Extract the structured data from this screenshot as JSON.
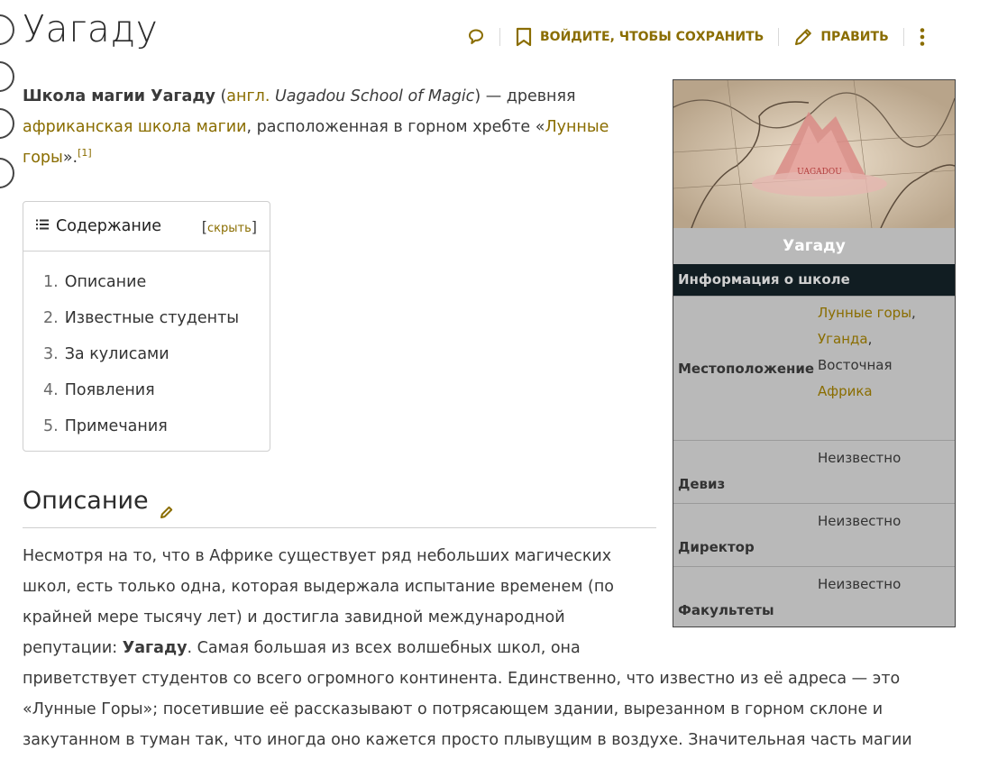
{
  "page": {
    "title": "Уагаду"
  },
  "actions": {
    "save_label": "ВОЙДИТЕ, ЧТОБЫ СОХРАНИТЬ",
    "edit_label": "ПРАВИТЬ"
  },
  "intro": {
    "bold": "Школа магии Уагаду",
    "open_paren": " (",
    "lang_link": "англ.",
    "english": " Uagadou School of Magic",
    "mid": ") — древняя ",
    "link1": "африканская школа магии",
    "mid2": ", расположенная в горном хребте «",
    "link2": "Лунные горы",
    "end": "».",
    "ref": "[1]"
  },
  "toc": {
    "title": "Содержание",
    "toggle_open": "[",
    "toggle_label": "скрыть",
    "toggle_close": "]",
    "items": [
      {
        "num": "1.",
        "label": "Описание"
      },
      {
        "num": "2.",
        "label": "Известные студенты"
      },
      {
        "num": "3.",
        "label": "За кулисами"
      },
      {
        "num": "4.",
        "label": "Появления"
      },
      {
        "num": "5.",
        "label": "Примечания"
      }
    ]
  },
  "section": {
    "heading": "Описание",
    "p1_a": "Несмотря на то, что в Африке существует ряд небольших магических школ, есть только одна, которая выдержала испытание временем (по крайней мере тысячу лет) и достигла завидной международной репутации: ",
    "p1_bold": "Уагаду",
    "p1_b": ". Самая большая из всех волшебных школ, она",
    "p2": "приветствует студентов со всего огромного континента. Единственно, что известно из её адреса — это «Лунные Горы»; посетившие её рассказывают о потрясающем здании, вырезанном в горном склоне и закутанном в туман так, что иногда оно кажется просто плывущим в воздухе. Значительная часть магии"
  },
  "infobox": {
    "image_caption_text": "UAGADOU",
    "title": "Уагаду",
    "header": "Информация о школе",
    "location_label": "Местоположение",
    "location": {
      "link1": "Лунные горы",
      "comma1": ",",
      "link2": "Уганда",
      "comma2": ",",
      "text": "Восточная",
      "link3": "Африка"
    },
    "motto_label": "Девиз",
    "motto": "Неизвестно",
    "head_label": "Директор",
    "head": "Неизвестно",
    "houses_label": "Факультеты",
    "houses": "Неизвестно"
  },
  "colors": {
    "link": "#8a6d00",
    "infobox_bg": "#b9b9b9",
    "infobox_header": "#111d22"
  }
}
